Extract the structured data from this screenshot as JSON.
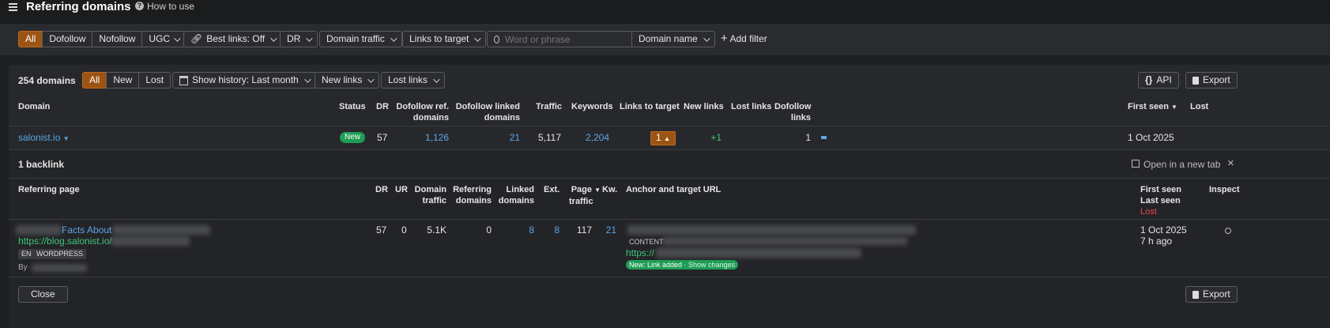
{
  "header": {
    "title": "Referring domains",
    "how_to_use": "How to use"
  },
  "filters": {
    "link_types": [
      "All",
      "Dofollow",
      "Nofollow",
      "UGC"
    ],
    "best_links": "Best links: Off",
    "dr": "DR",
    "domain_traffic": "Domain traffic",
    "links_to_target": "Links to target",
    "search_placeholder": "Word or phrase",
    "domain_name": "Domain name",
    "add_filter": "Add filter"
  },
  "toolbar": {
    "count": "254 domains",
    "status_tabs": [
      "All",
      "New",
      "Lost"
    ],
    "show_history": "Show history: Last month",
    "new_links": "New links",
    "lost_links": "Lost links",
    "api": "API",
    "export": "Export"
  },
  "table": {
    "columns": {
      "domain": "Domain",
      "status": "Status",
      "dr": "DR",
      "dofollow_ref_domains_1": "Dofollow ref.",
      "dofollow_ref_domains_2": "domains",
      "dofollow_linked_1": "Dofollow linked",
      "dofollow_linked_2": "domains",
      "traffic": "Traffic",
      "keywords": "Keywords",
      "links_to_target": "Links to target",
      "new_links": "New links",
      "lost_links": "Lost links",
      "dofollow_links_1": "Dofollow",
      "dofollow_links_2": "links",
      "first_seen": "First seen",
      "lost": "Lost"
    },
    "row": {
      "domain": "salonist.io",
      "status": "New",
      "dr": "57",
      "dofollow_ref_domains": "1,126",
      "dofollow_linked_domains": "21",
      "traffic": "5,117",
      "keywords": "2,204",
      "links_to_target": "1",
      "new_links": "+1",
      "dofollow_links": "1",
      "first_seen": "1 Oct 2025"
    }
  },
  "backlinks": {
    "title": "1 backlink",
    "open_new_tab": "Open in a new tab",
    "columns": {
      "referring_page": "Referring page",
      "dr": "DR",
      "ur": "UR",
      "domain_traffic_1": "Domain",
      "domain_traffic_2": "traffic",
      "referring_domains_1": "Referring",
      "referring_domains_2": "domains",
      "linked_domains_1": "Linked",
      "linked_domains_2": "domains",
      "ext": "Ext.",
      "page_traffic_1": "Page",
      "page_traffic_2": "traffic",
      "kw": "Kw.",
      "anchor": "Anchor and target URL",
      "first_seen": "First seen",
      "last_seen": "Last seen",
      "lost": "Lost",
      "inspect": "Inspect"
    },
    "row": {
      "title": "Facts About",
      "url": "https://blog.salonist.io/",
      "tags": [
        "EN",
        "WORDPRESS"
      ],
      "by": "By",
      "dr": "57",
      "ur": "0",
      "domain_traffic": "5.1K",
      "referring_domains": "0",
      "linked_domains": "8",
      "ext": "8",
      "page_traffic": "117",
      "kw": "21",
      "content_tag": "CONTENT",
      "target_url": "https://",
      "change_badge": "New: Link added",
      "show_changes": "Show changes",
      "first_seen": "1 Oct 2025",
      "last_seen": "7 h ago"
    }
  },
  "footer": {
    "close": "Close",
    "export": "Export"
  },
  "colors": {
    "accent_orange": "#9c5414",
    "link_blue": "#5aa7e8",
    "green": "#3fc77a",
    "red": "#e5484d"
  }
}
